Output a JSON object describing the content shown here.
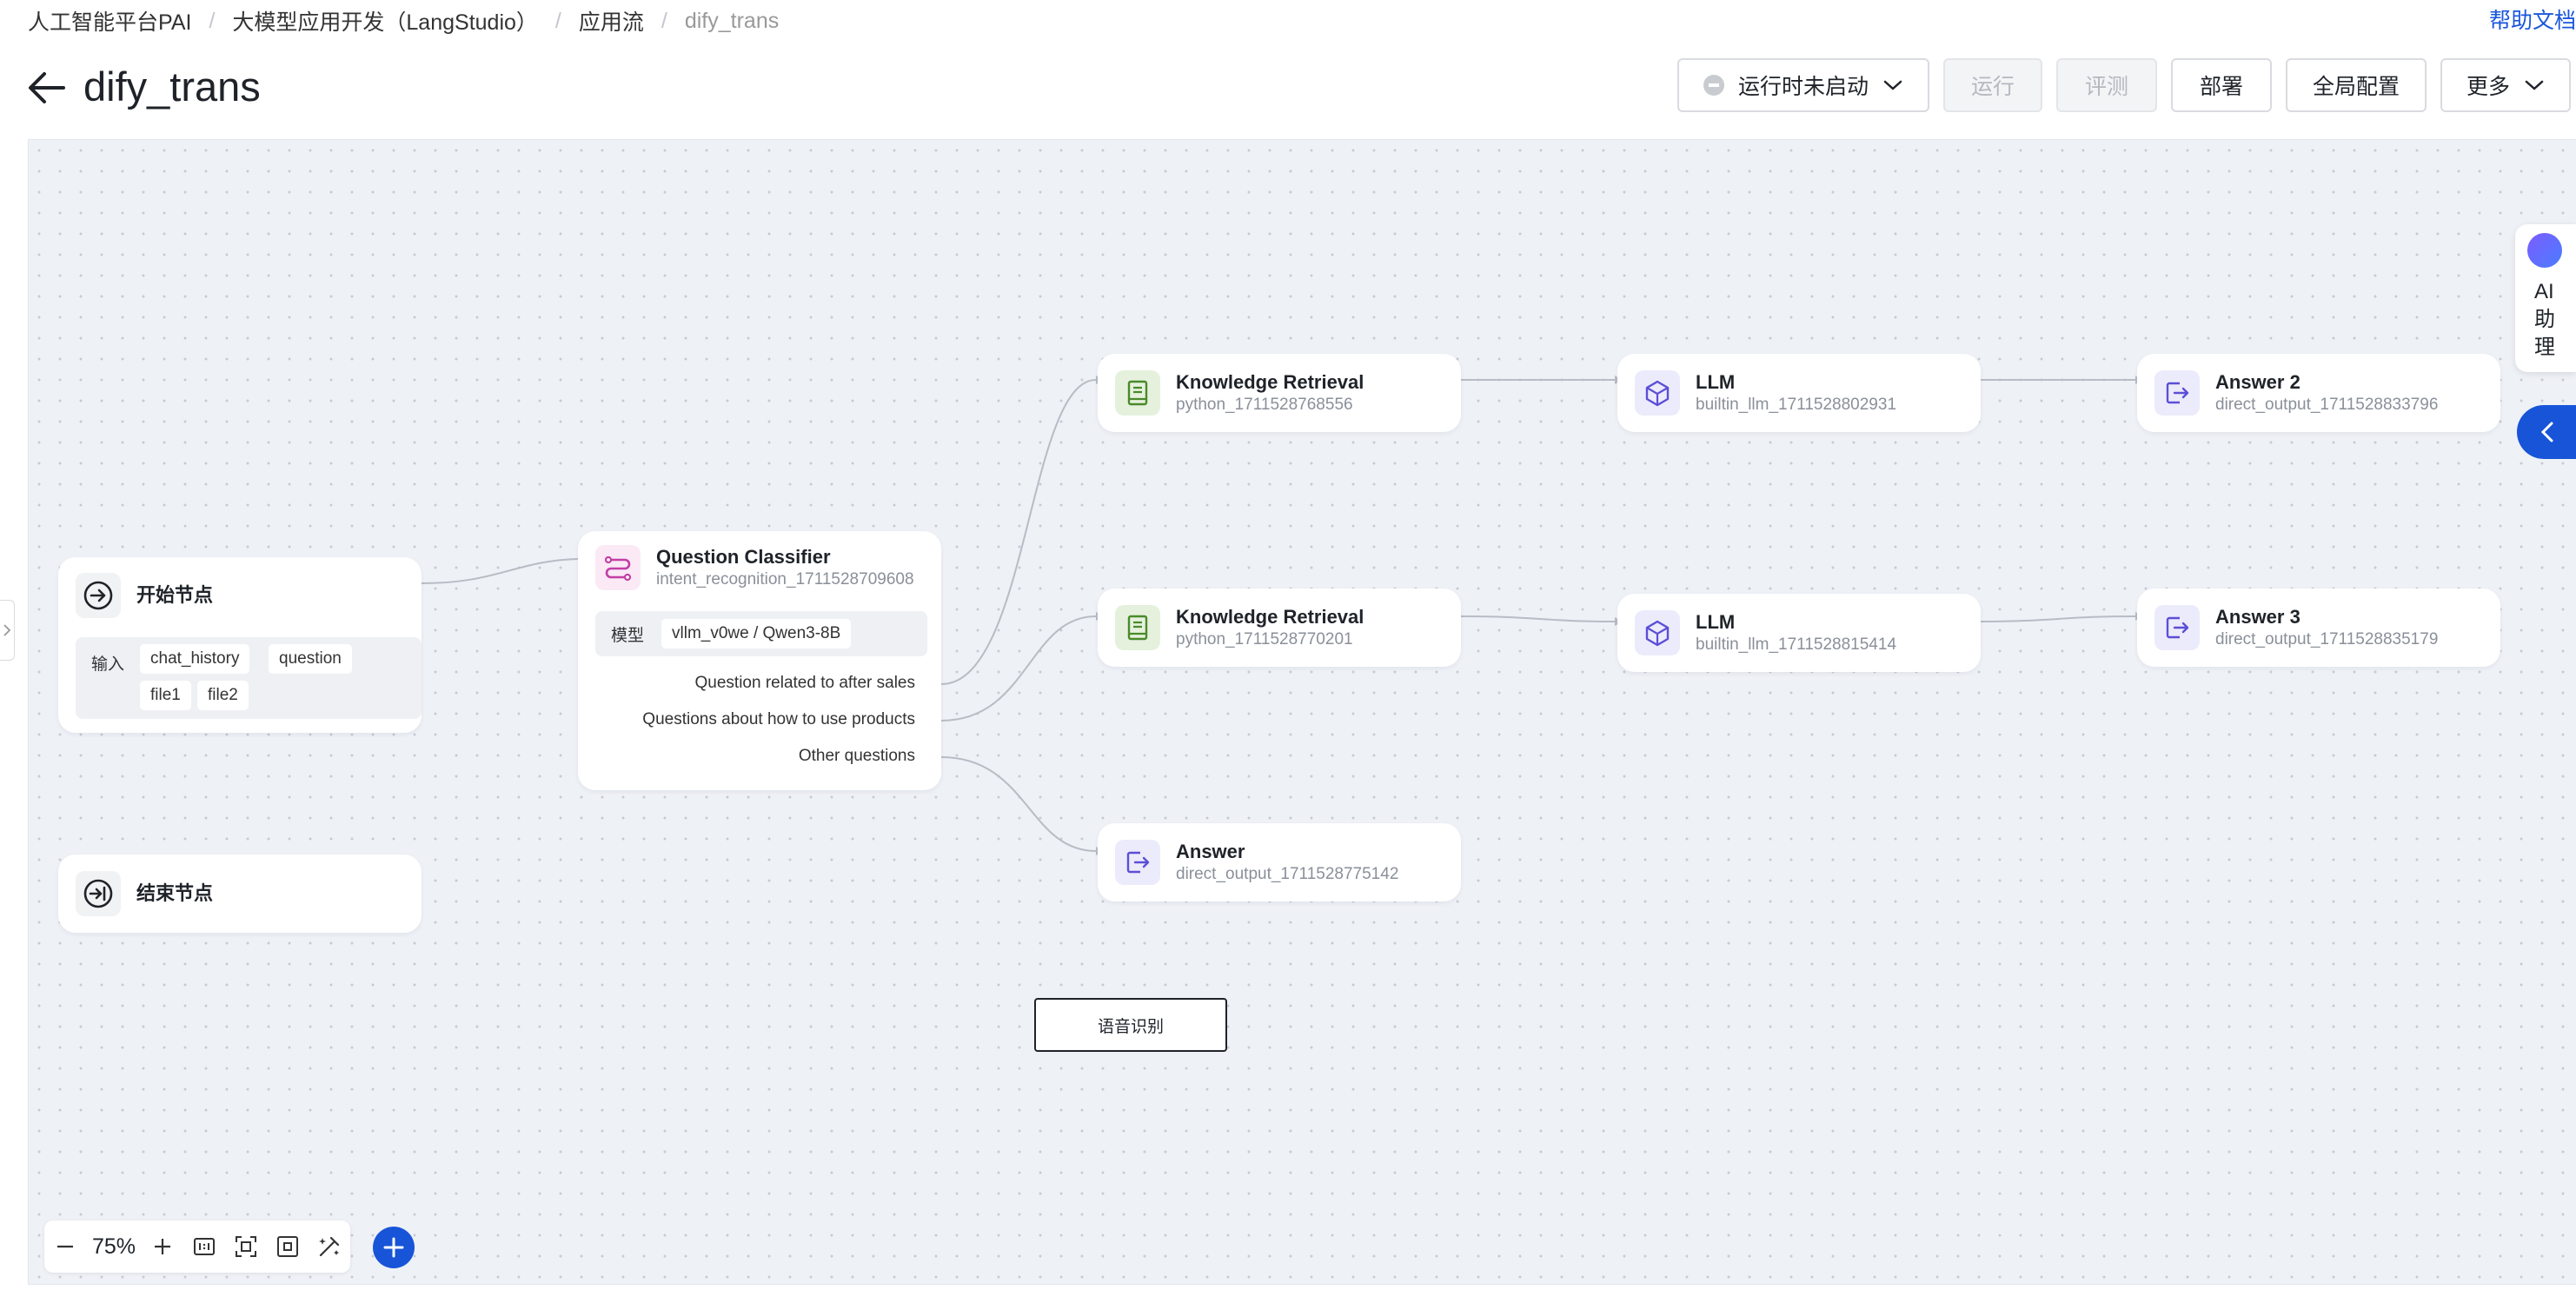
{
  "breadcrumb": {
    "items": [
      "人工智能平台PAI",
      "大模型应用开发（LangStudio）",
      "应用流",
      "dify_trans"
    ],
    "separator": "/"
  },
  "help_link": "帮助文档",
  "page": {
    "title": "dify_trans"
  },
  "toolbar": {
    "runtime_status": "运行时未启动",
    "run": "运行",
    "evaluate": "评测",
    "deploy": "部署",
    "global_config": "全局配置",
    "more": "更多"
  },
  "nodes": {
    "start": {
      "title": "开始节点",
      "input_label": "输入",
      "inputs": [
        "chat_history",
        "question",
        "file1",
        "file2"
      ]
    },
    "end": {
      "title": "结束节点"
    },
    "classifier": {
      "title": "Question Classifier",
      "id": "intent_recognition_1711528709608",
      "model_label": "模型",
      "model": "vllm_v0we / Qwen3-8B",
      "classes": [
        "Question related to after sales",
        "Questions about how to use products",
        "Other questions"
      ]
    },
    "kr1": {
      "title": "Knowledge Retrieval",
      "id": "python_1711528768556"
    },
    "kr2": {
      "title": "Knowledge Retrieval",
      "id": "python_1711528770201"
    },
    "answer": {
      "title": "Answer",
      "id": "direct_output_1711528775142"
    },
    "llm1": {
      "title": "LLM",
      "id": "builtin_llm_1711528802931"
    },
    "llm2": {
      "title": "LLM",
      "id": "builtin_llm_1711528815414"
    },
    "answer2": {
      "title": "Answer 2",
      "id": "direct_output_1711528833796"
    },
    "answer3": {
      "title": "Answer 3",
      "id": "direct_output_1711528835179"
    }
  },
  "annotation": {
    "label": "语音识别"
  },
  "zoom": {
    "level": "75%"
  },
  "assistant": {
    "label": "AI助理"
  },
  "colors": {
    "accent": "#1754d8",
    "canvas_bg": "#eef1f6",
    "help_link": "#1a56db"
  }
}
